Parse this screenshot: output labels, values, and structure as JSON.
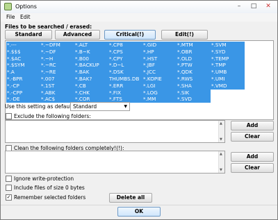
{
  "window": {
    "title": "Options",
    "controls": {
      "minimize": "–",
      "maximize": "□",
      "close": "✕"
    }
  },
  "menu": {
    "file": "File",
    "edit": "Edit"
  },
  "files_label": "Files to be searched / erased:",
  "preset_buttons": {
    "standard": "Standard",
    "advanced": "Advanced",
    "critical": "Critical(!)",
    "edit": "Edit(!)"
  },
  "file_types": [
    "*.---",
    "*.~DFM",
    "*.ALT",
    "*.CP8",
    "*.GID",
    "*.MTM",
    "*.SVM",
    "*.$$$",
    "*.~DF",
    "*.B~K",
    "*.CPS",
    "*.HP",
    "*.OBR",
    "*.SYD",
    "*.$AC",
    "*.~H",
    "*.B00",
    "*.CPY",
    "*.HST",
    "*.OLD",
    "*.TEMP",
    "*.$SYM",
    "*.~RC",
    "*.BACKUP",
    "*.D~L",
    "*.JBF",
    "*.PTW",
    "*.TMP",
    "*.A",
    "*.~RE",
    "*.BAK",
    "*.DSK",
    "*.JCC",
    "*.QDK",
    "*.UMB",
    "*.-BPR",
    "*.007",
    "*.BAK?",
    "THUMBS.DB",
    "*.KOPIE",
    "*.RWS",
    "*.UMI",
    "*.-CP",
    "*.1ST",
    "*.CB",
    "*.ERR",
    "*.LGI",
    "*.SHA",
    "*.VMD",
    "*.-CPP",
    "*.ABK",
    "*.CHK",
    "*.FIX",
    "*.LOG",
    "*.SIK",
    "",
    "*.-DE",
    "*.AC$",
    "*.COR",
    "*.FTS",
    "*.MM",
    "*.SVD",
    ""
  ],
  "default_setting": {
    "label": "Use this setting as default",
    "value": "Standard"
  },
  "exclude": {
    "label": "Exclude the following folders:",
    "add": "Add",
    "clear": "Clear"
  },
  "clean": {
    "label": "Clean the following folders completely!(!):",
    "add": "Add",
    "clear": "Clear"
  },
  "options": {
    "ignore_write_protection": {
      "label": "Ignore write-protection",
      "checked": false
    },
    "include_zero_bytes": {
      "label": "Include files of size 0 bytes",
      "checked": false
    },
    "remember_folders": {
      "label": "Remember selected folders",
      "checked": true
    }
  },
  "delete_all": "Delete all",
  "ok": "OK"
}
